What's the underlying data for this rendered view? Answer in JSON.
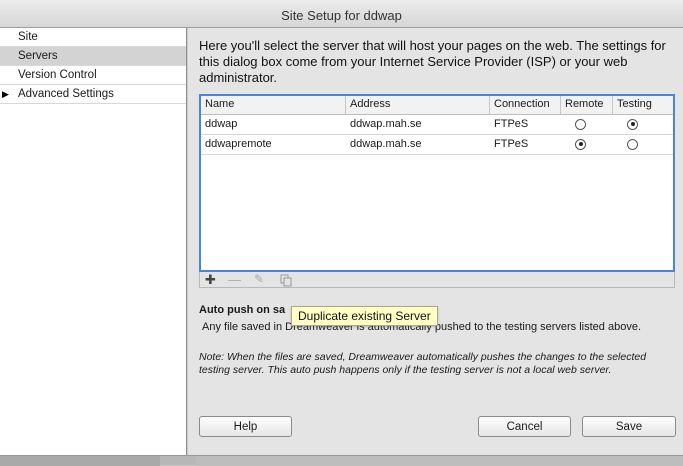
{
  "window": {
    "title": "Site Setup for ddwap"
  },
  "sidebar": {
    "items": [
      {
        "label": "Site"
      },
      {
        "label": "Servers"
      },
      {
        "label": "Version Control"
      },
      {
        "label": "Advanced Settings"
      }
    ]
  },
  "main": {
    "intro": "Here you'll select the server that will host your pages on the web. The settings for this dialog box come from your Internet Service Provider (ISP) or your web administrator."
  },
  "table": {
    "headers": {
      "name": "Name",
      "address": "Address",
      "connection": "Connection",
      "remote": "Remote",
      "testing": "Testing"
    },
    "rows": [
      {
        "name": "ddwap",
        "address": "ddwap.mah.se",
        "connection": "FTPeS",
        "remote": false,
        "testing": true
      },
      {
        "name": "ddwapremote",
        "address": "ddwap.mah.se",
        "connection": "FTPeS",
        "remote": true,
        "testing": false
      }
    ]
  },
  "toolbar": {
    "add_icon": "plus-icon",
    "remove_icon": "minus-icon",
    "edit_icon": "pencil-icon",
    "duplicate_icon": "duplicate-icon"
  },
  "tooltip": {
    "text": "Duplicate existing Server"
  },
  "autopush": {
    "label": "Auto push on sa",
    "text": "Any file saved in Dreamweaver is automatically pushed to the testing servers listed above."
  },
  "note": {
    "text": "Note: When the files are saved, Dreamweaver automatically pushes the changes to the selected testing server. This auto push happens only if the testing server is not a local web server."
  },
  "buttons": {
    "help": "Help",
    "cancel": "Cancel",
    "save": "Save"
  },
  "colors": {
    "accent": "#4a86d8",
    "selected_row": "#d3d3d3",
    "tooltip_bg": "#ffffc6"
  }
}
